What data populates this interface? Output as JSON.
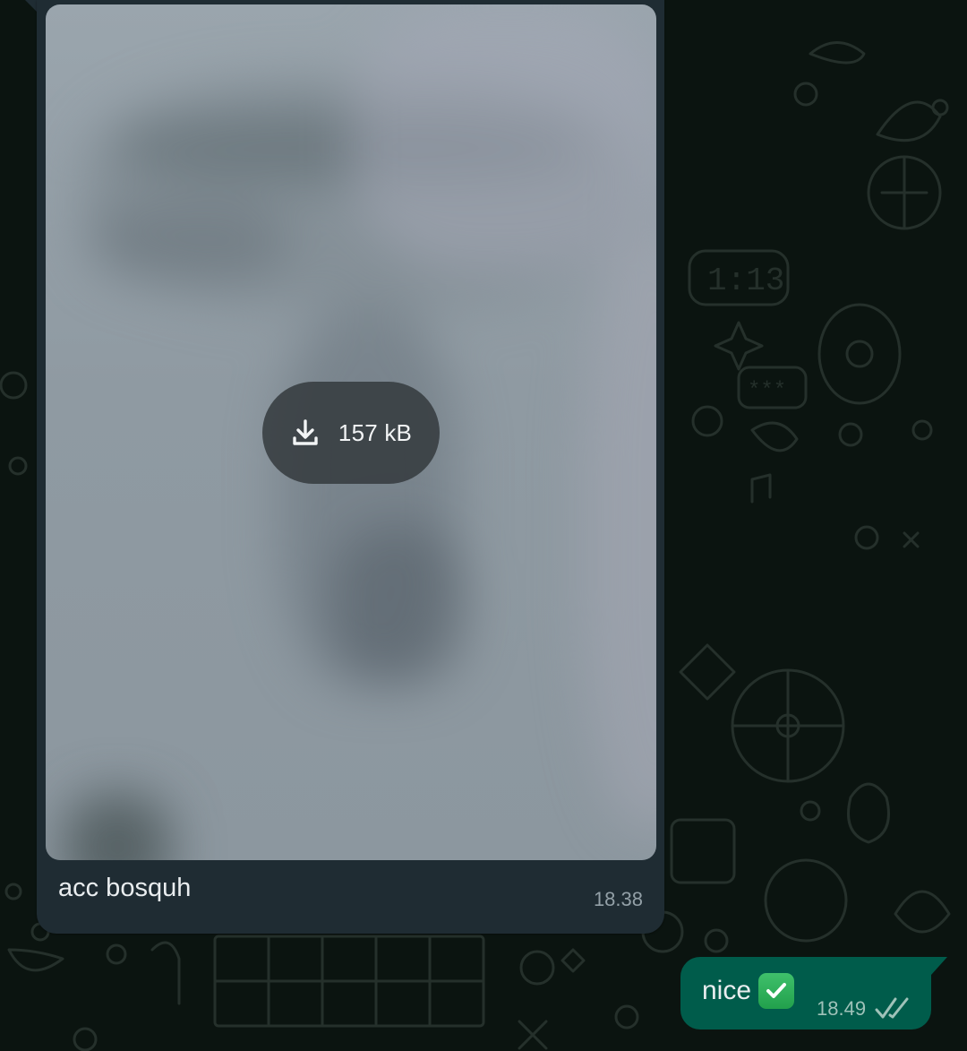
{
  "chat": {
    "incoming": {
      "attachment": {
        "size_label": "157 kB",
        "icon": "download-icon"
      },
      "caption": "acc bosquh",
      "time": "18.38"
    },
    "outgoing": {
      "text": "nice",
      "emoji": "check-mark-emoji",
      "time": "18.49",
      "status_icon": "double-check-icon"
    }
  },
  "colors": {
    "background": "#0b1410",
    "incoming_bubble": "#1f2c33",
    "outgoing_bubble": "#005c4b"
  }
}
